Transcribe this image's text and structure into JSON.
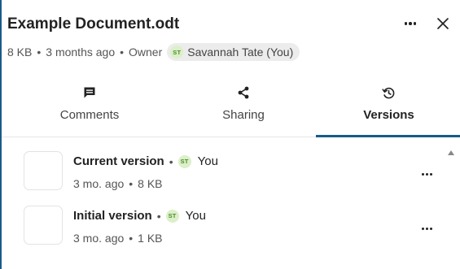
{
  "file": {
    "title": "Example Document.odt",
    "size": "8 KB",
    "modified": "3 months ago",
    "owner_label": "Owner",
    "owner_initials": "ST",
    "owner_name": "Savannah Tate (You)"
  },
  "header": {
    "more_icon": "more-horizontal-icon",
    "close_icon": "close-icon"
  },
  "tabs": [
    {
      "label": "Comments",
      "icon": "comment-icon",
      "active": false
    },
    {
      "label": "Sharing",
      "icon": "share-icon",
      "active": false
    },
    {
      "label": "Versions",
      "icon": "history-icon",
      "active": true
    }
  ],
  "versions": [
    {
      "name": "Current version",
      "author_initials": "ST",
      "author": "You",
      "age": "3 mo. ago",
      "size": "8 KB"
    },
    {
      "name": "Initial version",
      "author_initials": "ST",
      "author": "You",
      "age": "3 mo. ago",
      "size": "1 KB"
    }
  ],
  "colors": {
    "accent": "#1a5a8a",
    "avatar_bg": "#dcefc9",
    "avatar_text": "#4a8f2c",
    "chip_bg": "#ececec"
  }
}
